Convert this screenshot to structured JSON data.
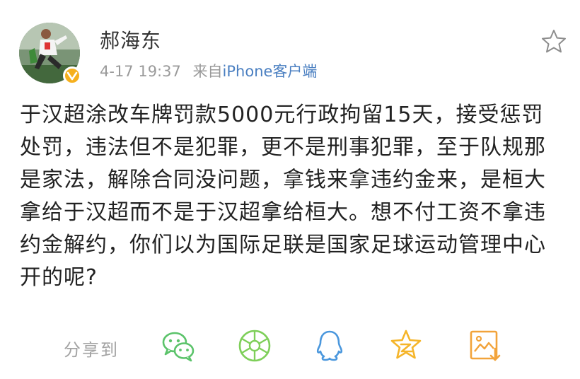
{
  "post": {
    "author_name": "郝海东",
    "time": "4-17 19:37",
    "source_prefix": "来自",
    "source_name": "iPhone客户端",
    "text": "于汉超涂改车牌罚款5000元行政拘留15天，接受惩罚处罚，违法但不是犯罪，更不是刑事犯罪，至于队规那是家法，解除合同没问题，拿钱来拿违约金来，是桓大拿给于汉超而不是于汉超拿给桓大。想不付工资不拿违约金解约，你们以为国际足联是国家足球运动管理中心开的呢?"
  },
  "share": {
    "label": "分享到",
    "targets": [
      {
        "name": "wechat-icon",
        "color": "#5bc36a"
      },
      {
        "name": "moments-icon",
        "color": "#7ecf59"
      },
      {
        "name": "qq-icon",
        "color": "#4a97dd"
      },
      {
        "name": "qzone-icon",
        "color": "#f5b52a"
      },
      {
        "name": "save-image-icon",
        "color": "#f2a33a"
      }
    ]
  },
  "colors": {
    "verified_badge": "#f6b01e",
    "link": "#4a7fc1",
    "text": "#222222",
    "secondary": "#9a9a9a"
  }
}
